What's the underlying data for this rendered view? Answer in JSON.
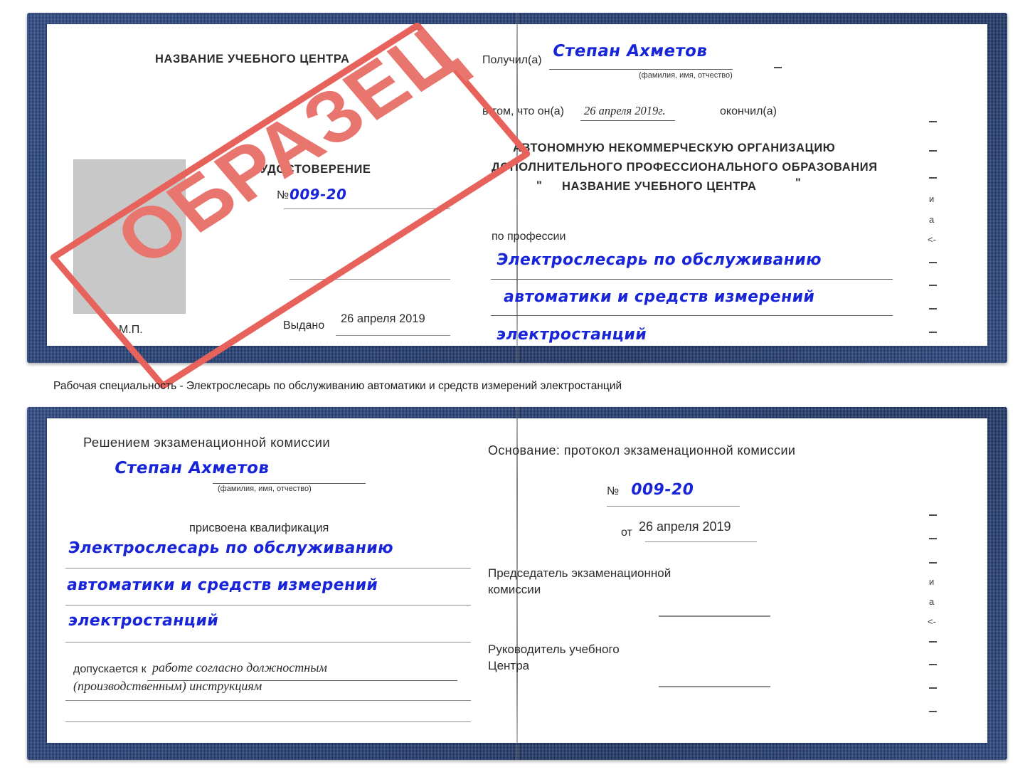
{
  "document": {
    "type": "certificate-scan",
    "stamp_label": "ОБРАЗЕЦ",
    "accent_blue": "#24407a",
    "stamp_red": "#e8625c",
    "ink_blue": "#1724d8"
  },
  "caption": {
    "text": "Рабочая специальность - Электрослесарь по обслуживанию автоматики и средств измерений электростанций"
  },
  "certificate_top": {
    "left_page": {
      "center_name": "НАЗВАНИЕ УЧЕБНОГО ЦЕНТРА",
      "title": "УДОСТОВЕРЕНИЕ",
      "number_label": "№",
      "number_value": "009-20",
      "issued_label": "Выдано",
      "issued_value": "26 апреля 2019",
      "seal_label": "М.П.",
      "photo_placeholder": "photo-placeholder"
    },
    "right_page": {
      "received_label": "Получил(а)",
      "received_value": "Степан Ахметов",
      "fio_hint": "(фамилия, имя, отчество)",
      "in_that_label": "в том, что он(а)",
      "date_value": "26 апреля 2019г.",
      "finished_label": "окончил(а)",
      "org_line1": "АВТОНОМНУЮ НЕКОММЕРЧЕСКУЮ ОРГАНИЗАЦИЮ",
      "org_line2": "ДОПОЛНИТЕЛЬНОГО ПРОФЕССИОНАЛЬНОГО ОБРАЗОВАНИЯ",
      "org_quote_open": "\"",
      "org_line3": "НАЗВАНИЕ УЧЕБНОГО ЦЕНТРА",
      "org_quote_close": "\"",
      "profession_label": "по профессии",
      "profession_line1": "Электрослесарь по обслуживанию",
      "profession_line2": "автоматики и средств измерений",
      "profession_line3": "электростанций",
      "edge_fragments": [
        "и",
        "а",
        "<-"
      ]
    }
  },
  "certificate_bottom": {
    "left_page": {
      "heading": "Решением экзаменационной комиссии",
      "name_value": "Степан Ахметов",
      "fio_hint": "(фамилия, имя, отчество)",
      "qualification_label": "присвоена квалификация",
      "qualification_line1": "Электрослесарь по обслуживанию",
      "qualification_line2": "автоматики и средств измерений",
      "qualification_line3": "электростанций",
      "admitted_label": "допускается к",
      "admitted_value_line1": "работе согласно должностным",
      "admitted_value_line2": "(производственным) инструкциям"
    },
    "right_page": {
      "basis_label": "Основание: протокол экзаменационной комиссии",
      "number_label": "№",
      "number_value": "009-20",
      "date_label": "от",
      "date_value": "26 апреля 2019",
      "chairman_line1": "Председатель экзаменационной",
      "chairman_line2": "комиссии",
      "head_line1": "Руководитель учебного",
      "head_line2": "Центра",
      "edge_fragments": [
        "и",
        "а",
        "<-"
      ]
    }
  }
}
